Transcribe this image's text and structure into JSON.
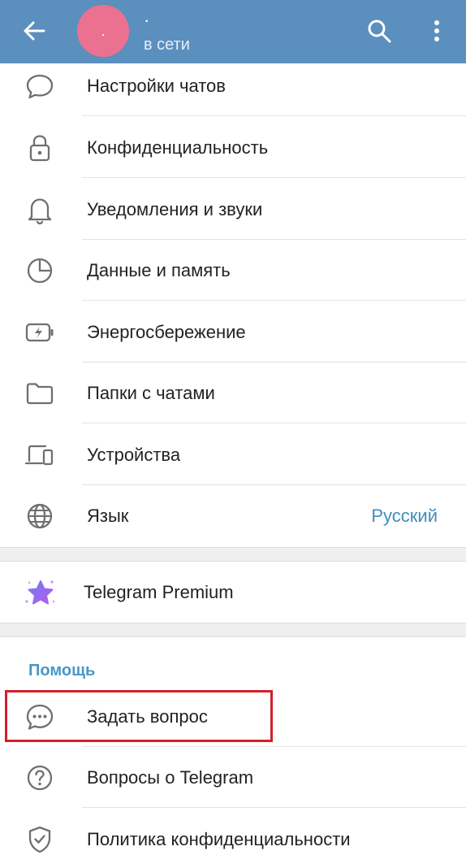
{
  "header": {
    "profile_name": "·",
    "avatar_letter": "·",
    "status": "в сети",
    "colors": {
      "header_bg": "#5b8fbe",
      "avatar_bg": "#ea7190"
    }
  },
  "settings": [
    {
      "label": "Настройки чатов",
      "icon": "chat-bubble-icon"
    },
    {
      "label": "Конфиденциальность",
      "icon": "lock-icon"
    },
    {
      "label": "Уведомления и звуки",
      "icon": "bell-icon"
    },
    {
      "label": "Данные и память",
      "icon": "pie-chart-icon"
    },
    {
      "label": "Энергосбережение",
      "icon": "battery-icon"
    },
    {
      "label": "Папки с чатами",
      "icon": "folder-icon"
    },
    {
      "label": "Устройства",
      "icon": "devices-icon"
    },
    {
      "label": "Язык",
      "value": "Русский",
      "icon": "globe-icon"
    }
  ],
  "premium": {
    "label": "Telegram Premium",
    "icon": "premium-star-icon"
  },
  "help": {
    "title": "Помощь",
    "items": [
      {
        "label": "Задать вопрос",
        "icon": "chat-dots-icon",
        "highlighted": true
      },
      {
        "label": "Вопросы о Telegram",
        "icon": "question-circle-icon"
      },
      {
        "label": "Политика конфиденциальности",
        "icon": "shield-check-icon"
      }
    ]
  },
  "colors": {
    "accent": "#4a96c5",
    "highlight_border": "#d4202a",
    "premium_star": "#8a63f0"
  }
}
